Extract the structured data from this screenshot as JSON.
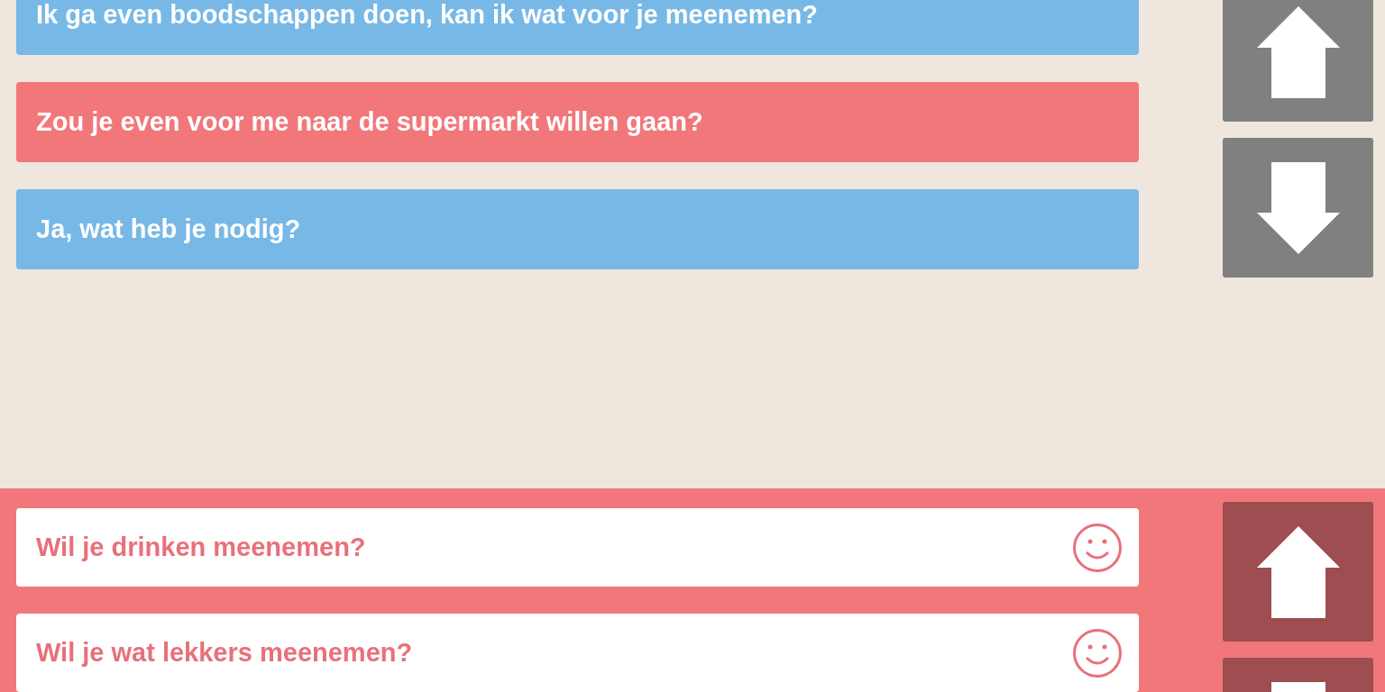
{
  "messages": [
    {
      "text": "Ik ga even boodschappen doen, kan ik wat voor je meenemen?",
      "color": "#77b8e6"
    },
    {
      "text": "Zou je even voor me naar de supermarkt willen gaan?",
      "color": "#f2777a"
    },
    {
      "text": "Ja, wat heb je nodig?",
      "color": "#77b8e6"
    }
  ],
  "options": [
    {
      "text": "Wil je drinken meenemen?"
    },
    {
      "text": "Wil je wat lekkers meenemen?"
    }
  ]
}
